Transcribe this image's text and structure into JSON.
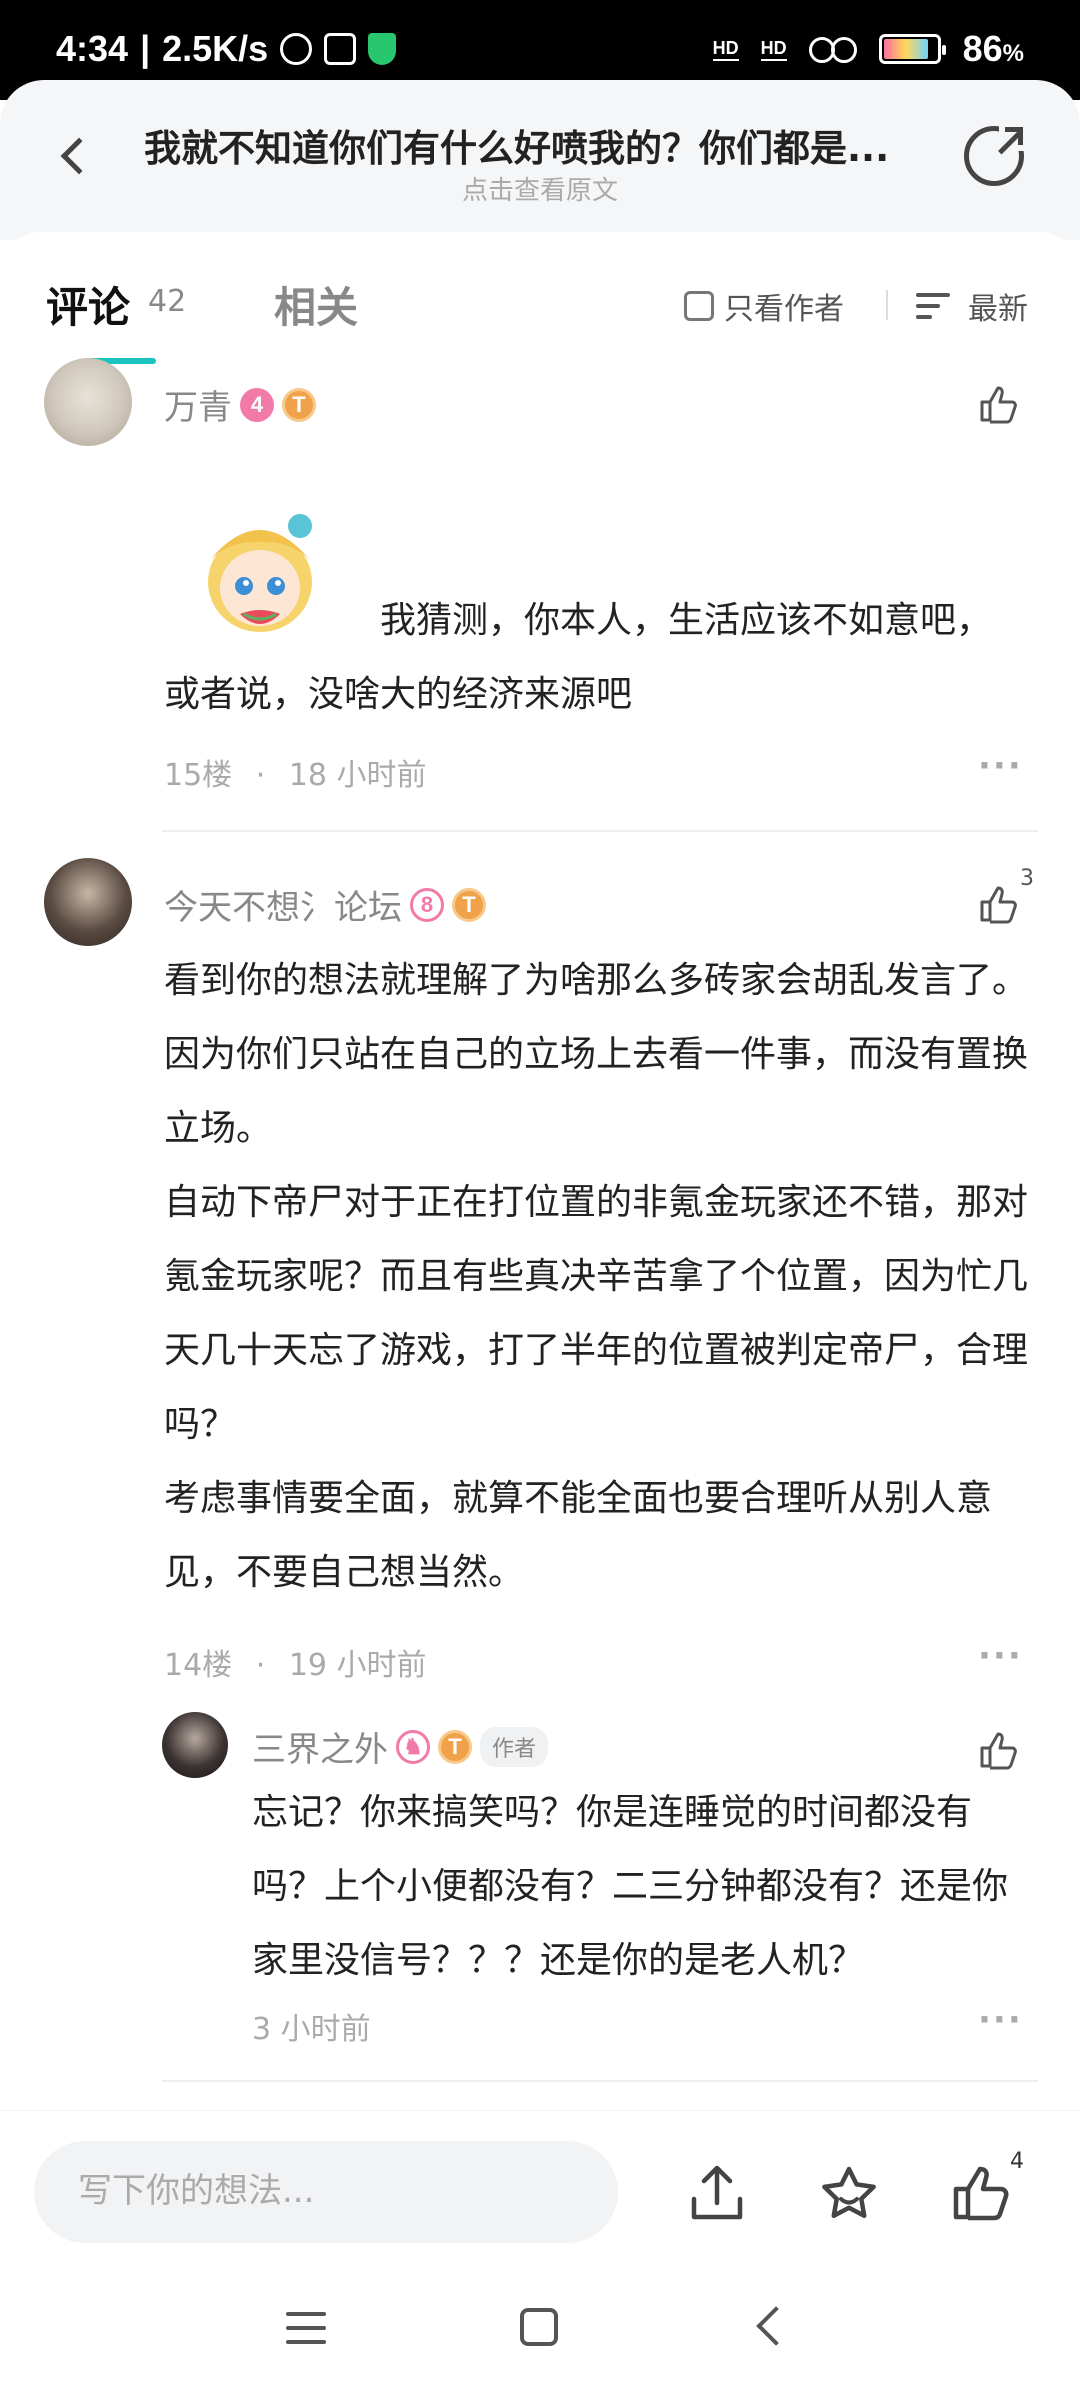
{
  "status_bar": {
    "time": "4:34",
    "speed": "2.5K/s",
    "hd1": "HD",
    "hd2": "HD",
    "battery": "86",
    "battery_unit": "%"
  },
  "header": {
    "title": "我就不知道你们有什么好喷我的？你们都是...",
    "subtitle": "点击查看原文"
  },
  "tabs": {
    "comments_label": "评论",
    "comments_count": "42",
    "related_label": "相关",
    "only_author_label": "只看作者",
    "sort_label": "最新"
  },
  "comments": [
    {
      "username": "万青",
      "level_badge": "4",
      "text_line1": "我猜测，你本人，生活应该不如意吧，",
      "text_line2": "或者说，没啥大的经济来源吧",
      "floor": "15楼",
      "time": "18 小时前"
    },
    {
      "username": "今天不想氵论坛",
      "level_badge": "8",
      "like_count": "3",
      "text": "看到你的想法就理解了为啥那么多砖家会胡乱发言了。因为你们只站在自己的立场上去看一件事，而没有置换立场。\n自动下帝尸对于正在打位置的非氪金玩家还不错，那对氪金玩家呢？而且有些真决辛苦拿了个位置，因为忙几天几十天忘了游戏，打了半年的位置被判定帝尸，合理吗？\n考虑事情要全面，就算不能全面也要合理听从别人意见，不要自己想当然。",
      "floor": "14楼",
      "time": "19 小时前",
      "reply": {
        "username": "三界之外",
        "author_tag": "作者",
        "text": "忘记？你来搞笑吗？你是连睡觉的时间都没有吗？上个小便都没有？二三分钟都没有？还是你家里没信号？？？还是你的是老人机？",
        "time": "3 小时前"
      }
    }
  ],
  "bottom_bar": {
    "input_placeholder": "写下你的想法...",
    "like_count": "4"
  },
  "colors": {
    "accent": "#1cc4c0",
    "badge_pink": "#f27aa8",
    "badge_orange": "#f0a24a"
  }
}
